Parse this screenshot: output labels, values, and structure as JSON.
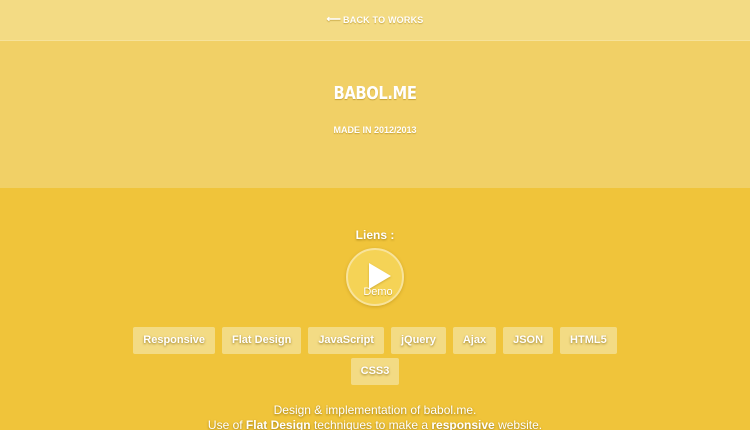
{
  "nav": {
    "back_label": "BACK TO WORKS",
    "back_icon": "left-arrow-icon"
  },
  "project": {
    "title": "BABOL.ME",
    "made_in": "MADE IN 2012/2013"
  },
  "links": {
    "label": "Liens :",
    "demo_label": "Demo",
    "demo_icon": "play-icon"
  },
  "tags": [
    "Responsive",
    "Flat Design",
    "JavaScript",
    "jQuery",
    "Ajax",
    "JSON",
    "HTML5",
    "CSS3"
  ],
  "description": {
    "line1": "Design & implementation of babol.me.",
    "line2_part1": "Use of ",
    "line2_bold1": "Flat Design",
    "line2_part2": " techniques to make a ",
    "line2_bold2": "responsive",
    "line2_part3": " website."
  },
  "colors": {
    "background": "#f0c43a",
    "hero": "#f1d066",
    "topbar": "#f3db84",
    "tag": "#f3db84"
  }
}
